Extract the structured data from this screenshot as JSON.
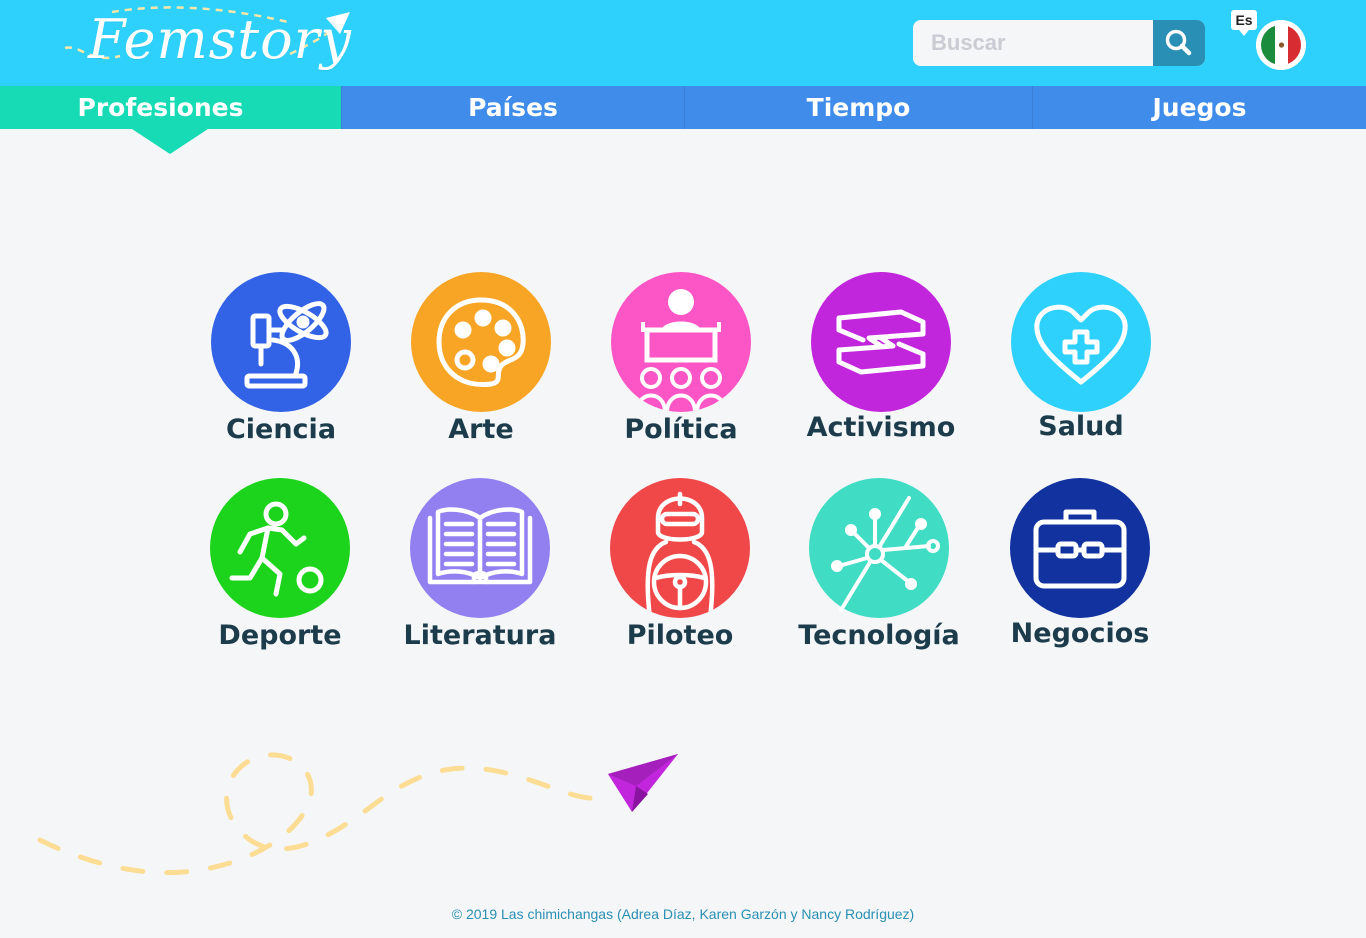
{
  "header": {
    "logo_text": "Femstory",
    "search": {
      "placeholder": "Buscar",
      "value": "",
      "button_icon": "search-icon"
    },
    "language": {
      "label": "Es",
      "flag_icon": "mexico-flag-icon"
    },
    "colors": {
      "header_bg": "#2dd1fb",
      "search_button": "#2a8fb4"
    }
  },
  "nav": {
    "tabs": [
      {
        "label": "Profesiones",
        "active": true
      },
      {
        "label": "Países",
        "active": false
      },
      {
        "label": "Tiempo",
        "active": false
      },
      {
        "label": "Juegos",
        "active": false
      }
    ],
    "colors": {
      "active": "#16dbb4",
      "inactive": "#3f8cea"
    }
  },
  "categories": [
    {
      "label": "Ciencia",
      "icon": "microscope-atom-icon",
      "color": "#3262e6"
    },
    {
      "label": "Arte",
      "icon": "palette-icon",
      "color": "#f8a526"
    },
    {
      "label": "Política",
      "icon": "podium-speaker-icon",
      "color": "#fc56c6"
    },
    {
      "label": "Activismo",
      "icon": "helping-hands-icon",
      "color": "#c226dc"
    },
    {
      "label": "Salud",
      "icon": "heart-cross-icon",
      "color": "#2dd1fb"
    },
    {
      "label": "Deporte",
      "icon": "soccer-player-icon",
      "color": "#1cd41c"
    },
    {
      "label": "Literatura",
      "icon": "open-book-icon",
      "color": "#9280f0"
    },
    {
      "label": "Piloteo",
      "icon": "race-driver-icon",
      "color": "#f04848"
    },
    {
      "label": "Tecnología",
      "icon": "network-nodes-icon",
      "color": "#40dcc4"
    },
    {
      "label": "Negocios",
      "icon": "briefcase-icon",
      "color": "#1232a0"
    }
  ],
  "footer": {
    "text": "© 2019 Las chimichangas (Adrea Díaz, Karen Garzón y Nancy Rodríguez)"
  }
}
